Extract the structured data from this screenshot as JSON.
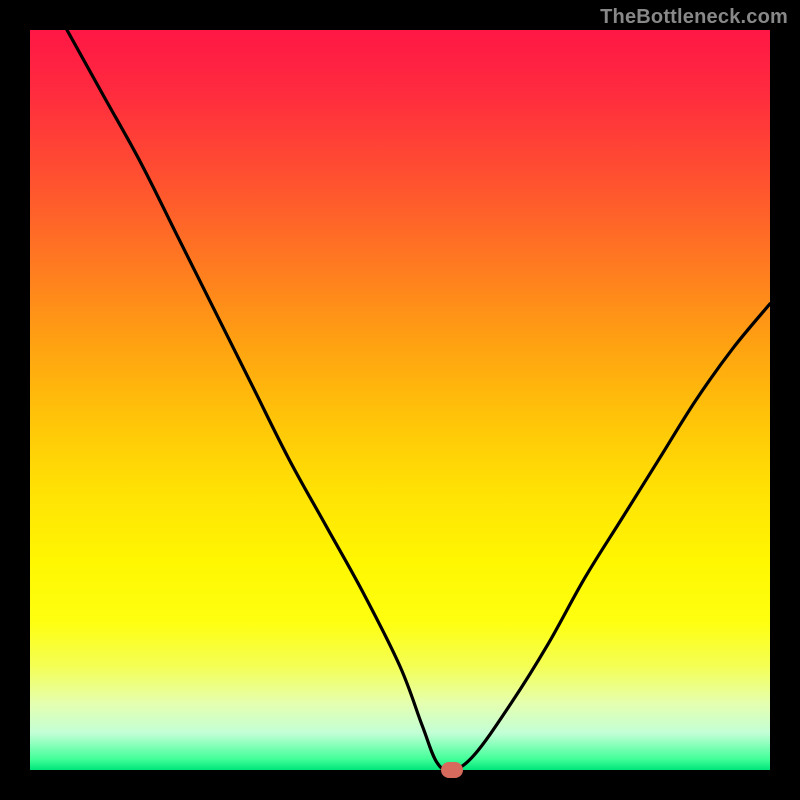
{
  "watermark": "TheBottleneck.com",
  "chart_data": {
    "type": "line",
    "title": "",
    "xlabel": "",
    "ylabel": "",
    "xlim": [
      0,
      100
    ],
    "ylim": [
      0,
      100
    ],
    "series": [
      {
        "name": "bottleneck-curve",
        "x": [
          5,
          10,
          15,
          20,
          25,
          30,
          35,
          40,
          45,
          50,
          53,
          55,
          57,
          60,
          65,
          70,
          75,
          80,
          85,
          90,
          95,
          100
        ],
        "values": [
          100,
          91,
          82,
          72,
          62,
          52,
          42,
          33,
          24,
          14,
          6,
          1,
          0,
          2,
          9,
          17,
          26,
          34,
          42,
          50,
          57,
          63
        ]
      }
    ],
    "marker": {
      "x": 57,
      "y": 0,
      "color": "#d66a5c"
    },
    "gradient_stops": [
      {
        "pos": 0,
        "color": "#ff1745"
      },
      {
        "pos": 0.5,
        "color": "#ffe104"
      },
      {
        "pos": 0.95,
        "color": "#c3ffd6"
      },
      {
        "pos": 1.0,
        "color": "#00e57a"
      }
    ]
  }
}
